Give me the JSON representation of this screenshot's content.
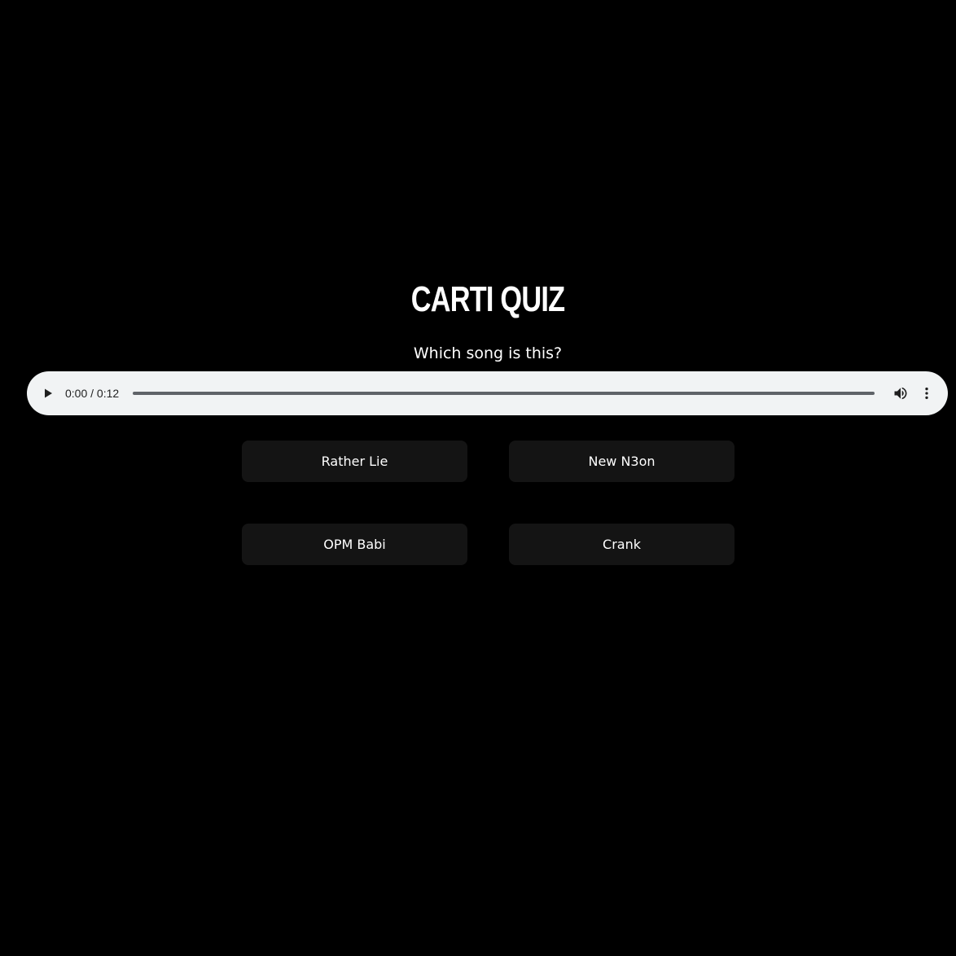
{
  "quiz": {
    "title": "CARTI QUIZ",
    "question": "Which song is this?"
  },
  "audio": {
    "time_display": "0:00 / 0:12",
    "current_time": "0:00",
    "duration": "0:12",
    "progress": 0,
    "play_icon": "play-icon",
    "volume_icon": "volume-icon",
    "more_icon": "more-vert-icon"
  },
  "answers": [
    {
      "label": "Rather Lie"
    },
    {
      "label": "New N3on"
    },
    {
      "label": "OPM Babi"
    },
    {
      "label": "Crank"
    }
  ],
  "colors": {
    "background": "#000000",
    "button_background": "#141414",
    "player_background": "#f1f3f4",
    "text": "#ffffff"
  }
}
